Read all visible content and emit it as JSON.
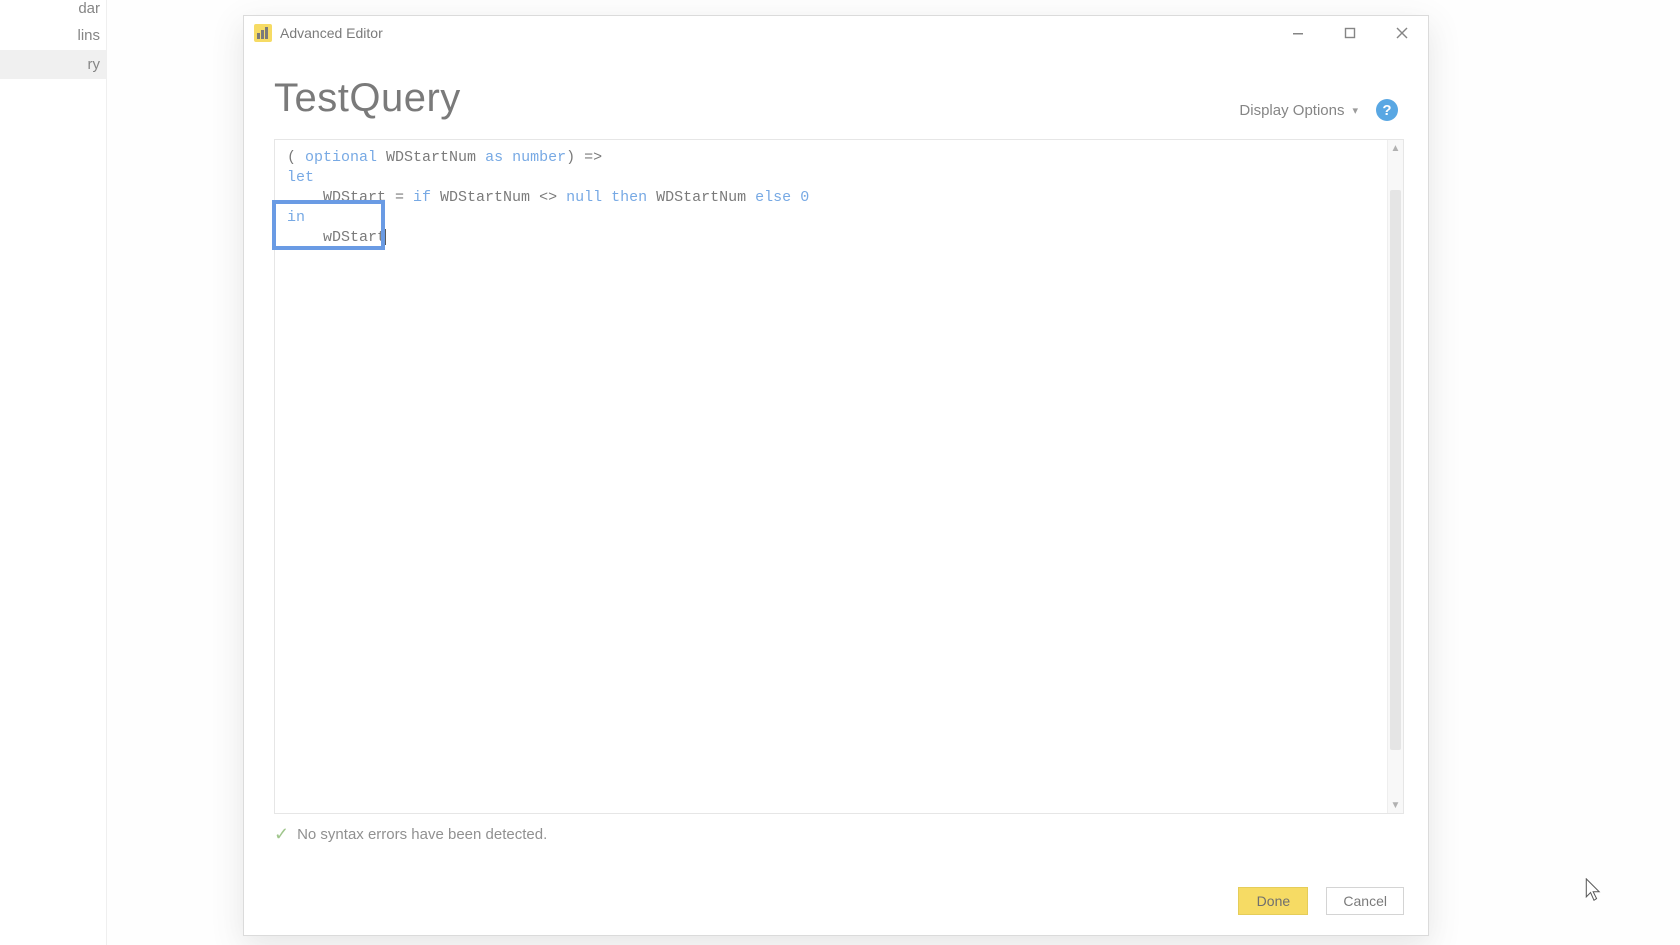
{
  "sidebar": {
    "items": [
      {
        "label": "dar"
      },
      {
        "label": "lins"
      },
      {
        "label": "ry"
      }
    ]
  },
  "dialog": {
    "title": "Advanced Editor",
    "query_name": "TestQuery",
    "display_options_label": "Display Options",
    "help_tooltip": "?",
    "code": {
      "line1_open": "( ",
      "line1_optional": "optional",
      "line1_mid": " WDStartNum ",
      "line1_as": "as",
      "line1_space2": " ",
      "line1_number": "number",
      "line1_close": ") =>",
      "line2_let": "let",
      "line3_indent": "    WDStart = ",
      "line3_if": "if",
      "line3_mid": " WDStartNum <> ",
      "line3_null": "null",
      "line3_sp": " ",
      "line3_then": "then",
      "line3_mid2": " WDStartNum ",
      "line3_else": "else",
      "line3_sp2": " ",
      "line3_zero": "0",
      "line4_in": "in",
      "line5_indent": "    ",
      "line5_val": "wDStart"
    },
    "status_message": "No syntax errors have been detected.",
    "done_label": "Done",
    "cancel_label": "Cancel"
  }
}
